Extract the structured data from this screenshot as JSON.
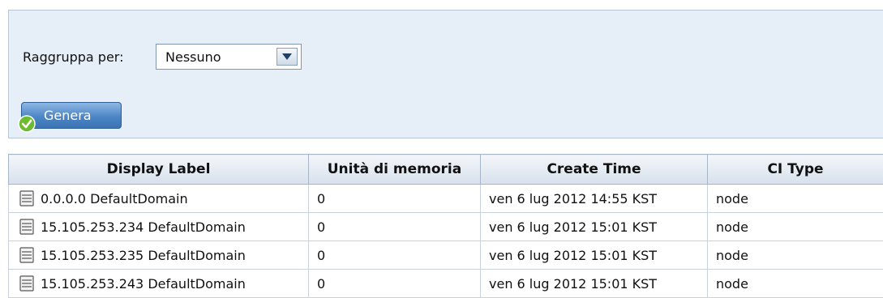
{
  "groupby": {
    "label": "Raggruppa per:",
    "selected": "Nessuno"
  },
  "generate_button": {
    "label": "Genera"
  },
  "table": {
    "headers": [
      "Display Label",
      "Unità di memoria",
      "Create Time",
      "CI Type"
    ],
    "rows": [
      {
        "display_label": "0.0.0.0 DefaultDomain",
        "memory_units": "0",
        "create_time": "ven 6 lug 2012 14:55 KST",
        "ci_type": "node"
      },
      {
        "display_label": "15.105.253.234 DefaultDomain",
        "memory_units": "0",
        "create_time": "ven 6 lug 2012 15:01 KST",
        "ci_type": "node"
      },
      {
        "display_label": "15.105.253.235 DefaultDomain",
        "memory_units": "0",
        "create_time": "ven 6 lug 2012 15:01 KST",
        "ci_type": "node"
      },
      {
        "display_label": "15.105.253.243 DefaultDomain",
        "memory_units": "0",
        "create_time": "ven 6 lug 2012 15:01 KST",
        "ci_type": "node"
      }
    ]
  },
  "icons": {
    "row_icon": "server-node-icon",
    "button_icon": "checkmark-badge-icon",
    "dropdown_icon": "chevron-down-icon"
  },
  "colors": {
    "panel_background": "#e6eef7",
    "button_blue": "#4c86c6",
    "check_green": "#6dbb2e"
  }
}
